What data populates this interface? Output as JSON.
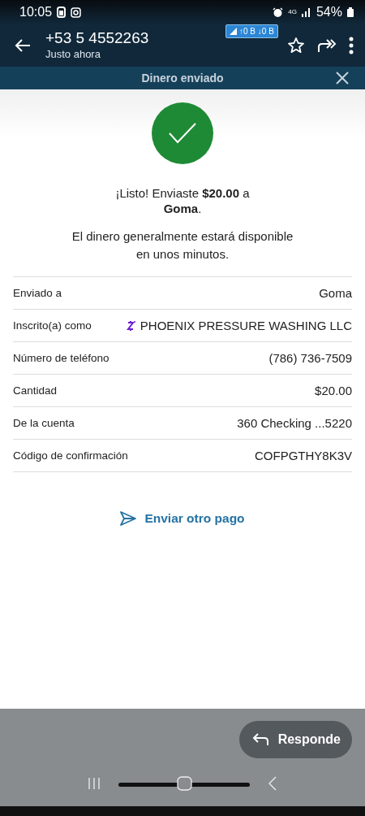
{
  "status_bar": {
    "time": "10:05",
    "network": "4G",
    "battery": "54%",
    "speed": "↑0 B ↓0 B"
  },
  "header": {
    "title": "+53 5 4552263",
    "subtitle": "Justo ahora"
  },
  "sheet": {
    "title": "Dinero enviado",
    "message": "¡Listo! Enviaste **$20.00** a **Goma**.",
    "note": "El dinero generalmente estará disponible en unos minutos.",
    "details": [
      {
        "label": "Enviado a",
        "value": "Goma",
        "kind": "plain"
      },
      {
        "label": "Inscrito(a) como",
        "value": "PHOENIX PRESSURE WASHING LLC",
        "kind": "zelle"
      },
      {
        "label": "Número de teléfono",
        "value": "(786) 736-7509",
        "kind": "plain"
      },
      {
        "label": "Cantidad",
        "value": "$20.00",
        "kind": "plain"
      },
      {
        "label": "De la cuenta",
        "value": "360 Checking ...5220",
        "kind": "plain"
      },
      {
        "label": "Código de confirmación",
        "value": "COFPGTHY8K3V",
        "kind": "plain"
      }
    ],
    "action": "Enviar otro pago"
  },
  "reply_button": "Responde"
}
